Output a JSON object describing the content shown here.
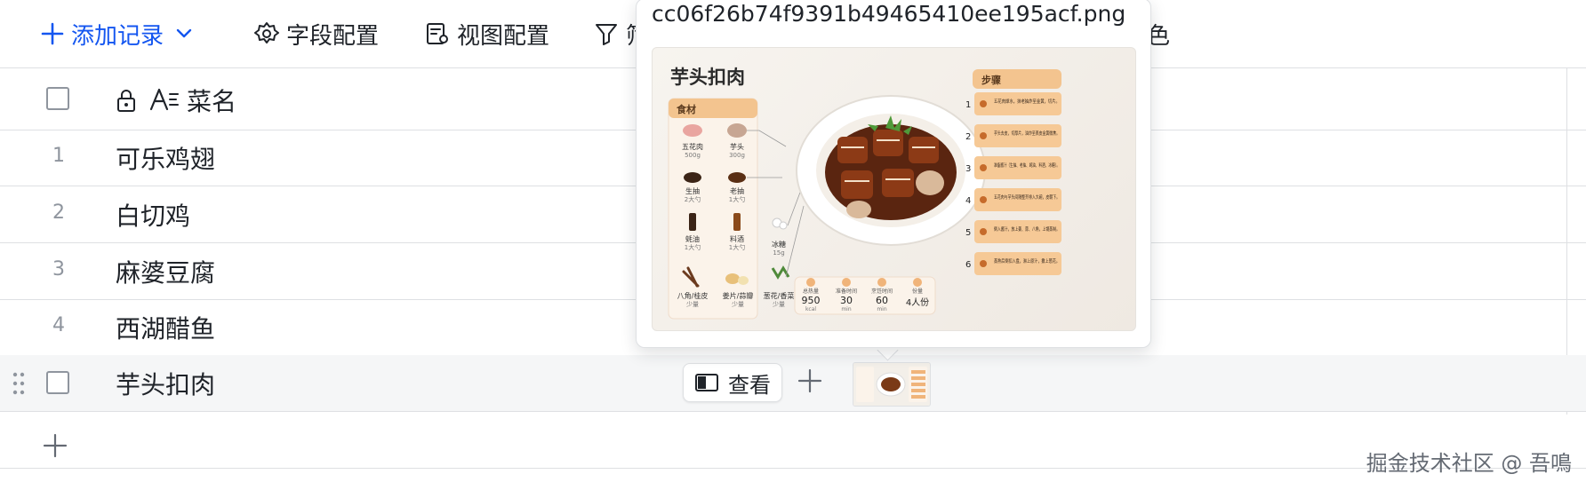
{
  "toolbar": {
    "add_record": "添加记录",
    "field_config": "字段配置",
    "view_config": "视图配置",
    "filter_label_partial": "筛",
    "color_label_partial": "色"
  },
  "table": {
    "header": {
      "field_name": "菜名"
    },
    "rows": [
      {
        "num": "1",
        "name": "可乐鸡翅"
      },
      {
        "num": "2",
        "name": "白切鸡"
      },
      {
        "num": "3",
        "name": "麻婆豆腐"
      },
      {
        "num": "4",
        "name": "西湖醋鱼"
      },
      {
        "num": "",
        "name": "芋头扣肉"
      }
    ],
    "view_button": "查看"
  },
  "preview": {
    "filename": "cc06f26b74f9391b49465410ee195acf.png",
    "image": {
      "title": "芋头扣肉",
      "ingredients_title": "食材",
      "ingredients": [
        {
          "name": "五花肉",
          "amount": "500g"
        },
        {
          "name": "芋头",
          "amount": "300g"
        },
        {
          "name": "生抽",
          "amount": "2大勺"
        },
        {
          "name": "老抽",
          "amount": "1大勺"
        },
        {
          "name": "蚝油",
          "amount": "1大勺"
        },
        {
          "name": "料酒",
          "amount": "1大勺"
        },
        {
          "name": "冰糖",
          "amount": "15g"
        },
        {
          "name": "八角/桂皮",
          "amount": "少量"
        },
        {
          "name": "姜片/蒜瓣",
          "amount": "少量"
        },
        {
          "name": "葱花/香菜",
          "amount": "少量"
        }
      ],
      "stats": [
        {
          "label": "总热量",
          "value": "950",
          "unit": "kcal"
        },
        {
          "label": "准备时间",
          "value": "30",
          "unit": "min"
        },
        {
          "label": "烹饪时间",
          "value": "60",
          "unit": "min"
        },
        {
          "label": "份量",
          "value": "4人份",
          "unit": ""
        }
      ],
      "steps_title": "步骤",
      "steps": [
        {
          "num": "1",
          "text": "五花肉焯水，抹老抽炸至金黄，切片。"
        },
        {
          "num": "2",
          "text": "芋头去皮，切厚片，油炸至表皮金黄微焦。"
        },
        {
          "num": "3",
          "text": "准备酱汁（生抽、老抽、蚝油、料酒、冰糖）。"
        },
        {
          "num": "4",
          "text": "五花肉与芋头间隔整齐排入大碗，皮朝下。"
        },
        {
          "num": "5",
          "text": "倒入酱汁，放上姜、蒜、八角，上锅蒸制。"
        },
        {
          "num": "6",
          "text": "蒸熟后倒扣入盘，淋上原汁，撒上葱花。"
        }
      ]
    }
  },
  "watermark": "掘金技术社区 @ 吾鳴",
  "colors": {
    "accent": "#1456f0",
    "border": "#dee0e3",
    "text": "#1f2329",
    "muted": "#8f959e",
    "hover_row": "#f5f6f7",
    "recipe_orange": "#f0b47a"
  }
}
